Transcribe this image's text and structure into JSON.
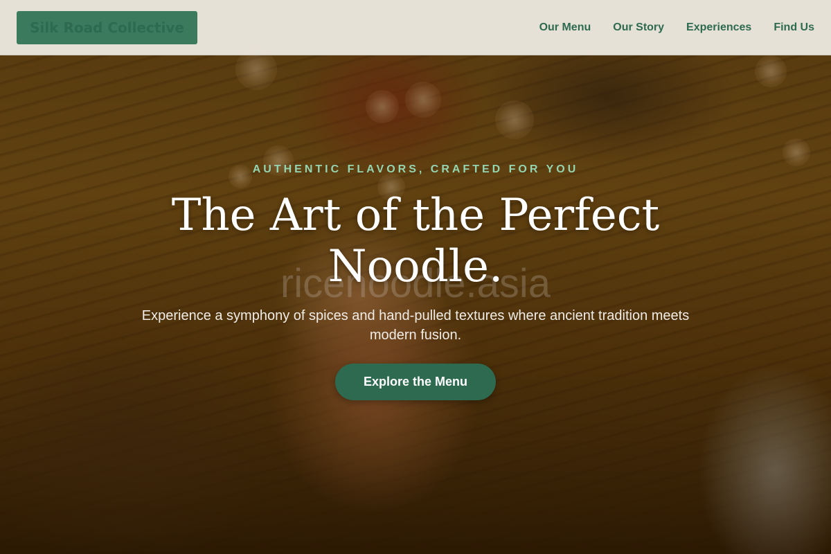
{
  "header": {
    "brand": "Silk Road Collective",
    "nav": [
      {
        "label": "Our Menu"
      },
      {
        "label": "Our Story"
      },
      {
        "label": "Experiences"
      },
      {
        "label": "Find Us"
      }
    ]
  },
  "hero": {
    "eyebrow": "AUTHENTIC FLAVORS, CRAFTED FOR YOU",
    "headline": "The Art of the Perfect Noodle.",
    "watermark": "ricenoodle.asia",
    "subtext": "Experience a symphony of spices and hand-pulled textures where ancient tradition meets modern fusion.",
    "cta_label": "Explore the Menu"
  },
  "colors": {
    "brand_green": "#2d6a4f",
    "accent_mint": "#95d5b2",
    "header_bg": "#ece8e0"
  }
}
